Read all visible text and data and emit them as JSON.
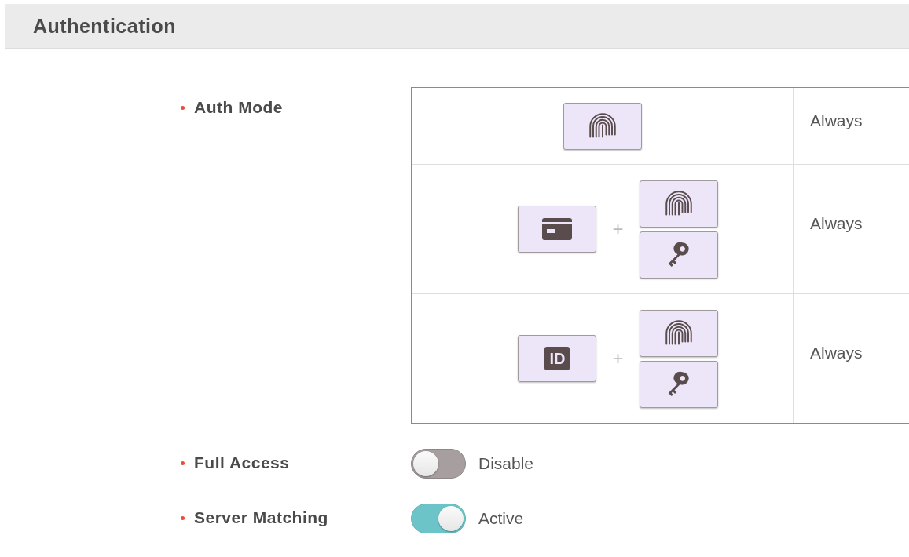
{
  "header": {
    "title": "Authentication"
  },
  "auth_mode": {
    "label": "Auth Mode",
    "required": true,
    "rows": [
      {
        "groups": [
          [
            {
              "kind": "fingerprint"
            }
          ]
        ],
        "schedule": "Always"
      },
      {
        "groups": [
          [
            {
              "kind": "card"
            }
          ],
          [
            {
              "kind": "fingerprint"
            },
            {
              "kind": "key"
            }
          ]
        ],
        "joiner": "+",
        "schedule": "Always"
      },
      {
        "groups": [
          [
            {
              "kind": "id",
              "text": "ID"
            }
          ],
          [
            {
              "kind": "fingerprint"
            },
            {
              "kind": "key"
            }
          ]
        ],
        "joiner": "+",
        "schedule": "Always"
      }
    ]
  },
  "toggles": [
    {
      "label": "Full Access",
      "required": true,
      "on": false,
      "status": "Disable"
    },
    {
      "label": "Server Matching",
      "required": true,
      "on": true,
      "status": "Active"
    }
  ]
}
